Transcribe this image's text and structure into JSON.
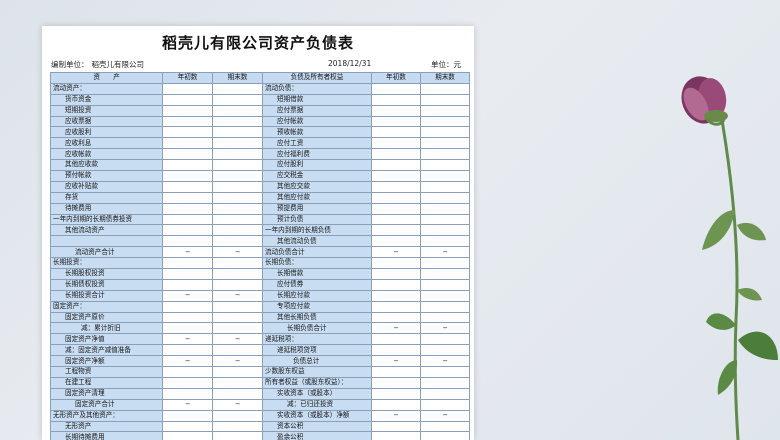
{
  "document": {
    "title": "稻壳儿有限公司资产负债表",
    "unit_label": "编制单位：",
    "unit_value": "稻壳儿有限公司",
    "date": "2018/12/31",
    "currency_label": "单位：",
    "currency_value": "元"
  },
  "table": {
    "headers": [
      "资　　产",
      "年初数",
      "期末数",
      "负债及所有者权益",
      "年初数",
      "期末数"
    ],
    "rows": [
      {
        "left": "流动资产：",
        "li": 0,
        "lb": "",
        "le": "",
        "right": "流动负债：",
        "ri": 0,
        "rb": "",
        "re": ""
      },
      {
        "left": "货币资金",
        "li": 1,
        "lb": "",
        "le": "",
        "right": "短期借款",
        "ri": 1,
        "rb": "",
        "re": ""
      },
      {
        "left": "短期投资",
        "li": 1,
        "lb": "",
        "le": "",
        "right": "应付票据",
        "ri": 1,
        "rb": "",
        "re": ""
      },
      {
        "left": "应收票据",
        "li": 1,
        "lb": "",
        "le": "",
        "right": "应付帐款",
        "ri": 1,
        "rb": "",
        "re": ""
      },
      {
        "left": "应收股利",
        "li": 1,
        "lb": "",
        "le": "",
        "right": "预收帐款",
        "ri": 1,
        "rb": "",
        "re": ""
      },
      {
        "left": "应收利息",
        "li": 1,
        "lb": "",
        "le": "",
        "right": "应付工资",
        "ri": 1,
        "rb": "",
        "re": ""
      },
      {
        "left": "应收帐款",
        "li": 1,
        "lb": "",
        "le": "",
        "right": "应付福利费",
        "ri": 1,
        "rb": "",
        "re": ""
      },
      {
        "left": "其他应收款",
        "li": 1,
        "lb": "",
        "le": "",
        "right": "应付股利",
        "ri": 1,
        "rb": "",
        "re": ""
      },
      {
        "left": "预付帐款",
        "li": 1,
        "lb": "",
        "le": "",
        "right": "应交税金",
        "ri": 1,
        "rb": "",
        "re": ""
      },
      {
        "left": "应收补贴款",
        "li": 1,
        "lb": "",
        "le": "",
        "right": "其他应交款",
        "ri": 1,
        "rb": "",
        "re": ""
      },
      {
        "left": "存货",
        "li": 1,
        "lb": "",
        "le": "",
        "right": "其他应付款",
        "ri": 1,
        "rb": "",
        "re": ""
      },
      {
        "left": "待摊费用",
        "li": 1,
        "lb": "",
        "le": "",
        "right": "预提费用",
        "ri": 1,
        "rb": "",
        "re": ""
      },
      {
        "left": "一年内到期的长期债券投资",
        "li": 0,
        "lb": "",
        "le": "",
        "right": "预计负债",
        "ri": 1,
        "rb": "",
        "re": ""
      },
      {
        "left": "其他流动资产",
        "li": 1,
        "lb": "",
        "le": "",
        "right": "一年内到期的长期负债",
        "ri": 0,
        "rb": "",
        "re": ""
      },
      {
        "left": "",
        "li": 0,
        "lb": "",
        "le": "",
        "right": "其他流动负债",
        "ri": 1,
        "rb": "",
        "re": ""
      },
      {
        "left": "流动资产合计",
        "li": 2,
        "lb": "−",
        "le": "−",
        "right": "流动负债合计",
        "ri": 0,
        "rb": "−",
        "re": "−"
      },
      {
        "left": "长期投资：",
        "li": 0,
        "lb": "",
        "le": "",
        "right": "长期负债：",
        "ri": 0,
        "rb": "",
        "re": ""
      },
      {
        "left": "长期股权投资",
        "li": 1,
        "lb": "",
        "le": "",
        "right": "长期借款",
        "ri": 1,
        "rb": "",
        "re": ""
      },
      {
        "left": "长期债权投资",
        "li": 1,
        "lb": "",
        "le": "",
        "right": "应付债券",
        "ri": 1,
        "rb": "",
        "re": ""
      },
      {
        "left": "长期投资合计",
        "li": 1,
        "lb": "−",
        "le": "−",
        "right": "长期应付款",
        "ri": 1,
        "rb": "",
        "re": ""
      },
      {
        "left": "固定资产：",
        "li": 0,
        "lb": "",
        "le": "",
        "right": "专项应付款",
        "ri": 1,
        "rb": "",
        "re": ""
      },
      {
        "left": "固定资产原价",
        "li": 1,
        "lb": "",
        "le": "",
        "right": "其他长期负债",
        "ri": 1,
        "rb": "",
        "re": ""
      },
      {
        "left": "减：累计折旧",
        "li": 3,
        "lb": "",
        "le": "",
        "right": "长期负债合计",
        "ri": 2,
        "rb": "−",
        "re": "−"
      },
      {
        "left": "固定资产净值",
        "li": 1,
        "lb": "−",
        "le": "−",
        "right": "递延税项：",
        "ri": 0,
        "rb": "",
        "re": ""
      },
      {
        "left": "减：固定资产减值准备",
        "li": 1,
        "lb": "",
        "le": "",
        "right": "递延税项贷项",
        "ri": 1,
        "rb": "",
        "re": ""
      },
      {
        "left": "固定资产净额",
        "li": 1,
        "lb": "−",
        "le": "−",
        "right": "负债总计",
        "ri": 3,
        "rb": "−",
        "re": "−"
      },
      {
        "left": "工程物资",
        "li": 1,
        "lb": "",
        "le": "",
        "right": "少数股东权益",
        "ri": 0,
        "rb": "",
        "re": ""
      },
      {
        "left": "在建工程",
        "li": 1,
        "lb": "",
        "le": "",
        "right": "所有者权益（或股东权益）：",
        "ri": 0,
        "rb": "",
        "re": ""
      },
      {
        "left": "固定资产清理",
        "li": 1,
        "lb": "",
        "le": "",
        "right": "实收资本（或股本）",
        "ri": 1,
        "rb": "",
        "re": ""
      },
      {
        "left": "固定资产合计",
        "li": 2,
        "lb": "−",
        "le": "−",
        "right": "减：已归还投资",
        "ri": 2,
        "rb": "",
        "re": ""
      },
      {
        "left": "无形资产及其他资产：",
        "li": 0,
        "lb": "",
        "le": "",
        "right": "实收资本（或股本）净额",
        "ri": 1,
        "rb": "−",
        "re": "−"
      },
      {
        "left": "无形资产",
        "li": 1,
        "lb": "",
        "le": "",
        "right": "资本公积",
        "ri": 1,
        "rb": "",
        "re": ""
      },
      {
        "left": "长期待摊费用",
        "li": 1,
        "lb": "",
        "le": "",
        "right": "盈余公积",
        "ri": 1,
        "rb": "",
        "re": ""
      }
    ]
  },
  "colors": {
    "label_cell": "#c9ddf2",
    "header_cell": "#c6daf1",
    "background": "#e3e8ee",
    "flower_petal": "#8a3f6a",
    "stem": "#5f8a4a"
  },
  "icons": {
    "decoration": "purple-flower-icon"
  }
}
